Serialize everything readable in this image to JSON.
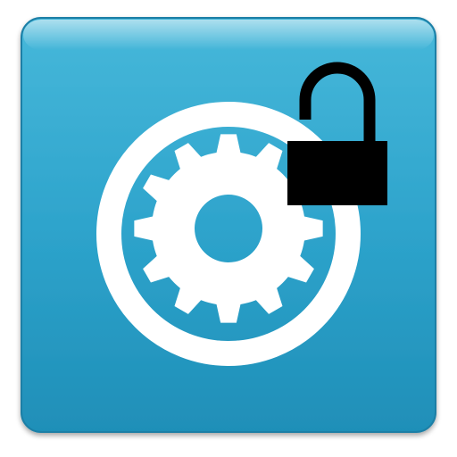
{
  "app_icon": {
    "name": "settings-unlock-app-icon",
    "icons": [
      "gear-icon",
      "ring-icon",
      "padlock-unlocked-icon"
    ],
    "colors": {
      "tile_top": "#47b8da",
      "tile_mid": "#2ea4cc",
      "tile_bottom": "#1f8fb8",
      "tile_edge": "#1a7fa6",
      "glyph": "#ffffff",
      "lock": "#000000"
    }
  }
}
